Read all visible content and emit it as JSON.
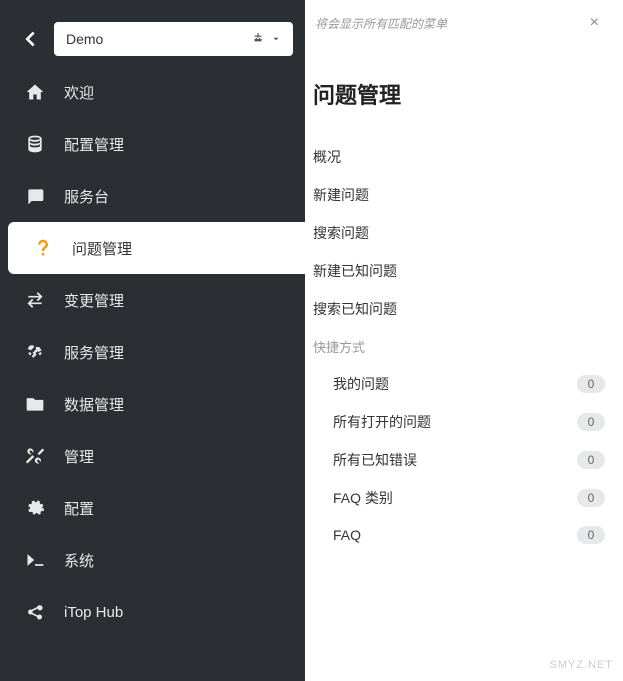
{
  "org_selector": {
    "label": "Demo"
  },
  "sidebar": {
    "items": [
      {
        "id": "welcome",
        "label": "欢迎",
        "icon": "home-icon"
      },
      {
        "id": "config",
        "label": "配置管理",
        "icon": "database-icon"
      },
      {
        "id": "helpdesk",
        "label": "服务台",
        "icon": "comment-icon"
      },
      {
        "id": "problem",
        "label": "问题管理",
        "icon": "question-icon",
        "active": true
      },
      {
        "id": "change",
        "label": "变更管理",
        "icon": "exchange-icon"
      },
      {
        "id": "service",
        "label": "服务管理",
        "icon": "handshake-icon"
      },
      {
        "id": "data",
        "label": "数据管理",
        "icon": "folder-icon"
      },
      {
        "id": "manage",
        "label": "管理",
        "icon": "tools-icon"
      },
      {
        "id": "settings",
        "label": "配置",
        "icon": "gear-icon"
      },
      {
        "id": "system",
        "label": "系统",
        "icon": "terminal-icon"
      },
      {
        "id": "hub",
        "label": "iTop Hub",
        "icon": "share-icon"
      }
    ]
  },
  "search": {
    "placeholder": "将会显示所有匹配的菜单"
  },
  "main": {
    "title": "问题管理",
    "links": [
      {
        "label": "概况"
      },
      {
        "label": "新建问题"
      },
      {
        "label": "搜索问题"
      },
      {
        "label": "新建已知问题"
      },
      {
        "label": "搜索已知问题"
      }
    ],
    "shortcuts_label": "快捷方式",
    "shortcuts": [
      {
        "label": "我的问题",
        "count": "0"
      },
      {
        "label": "所有打开的问题",
        "count": "0"
      },
      {
        "label": "所有已知错误",
        "count": "0"
      },
      {
        "label": "FAQ 类别",
        "count": "0"
      },
      {
        "label": "FAQ",
        "count": "0"
      }
    ]
  },
  "watermark": "SMYZ.NET"
}
